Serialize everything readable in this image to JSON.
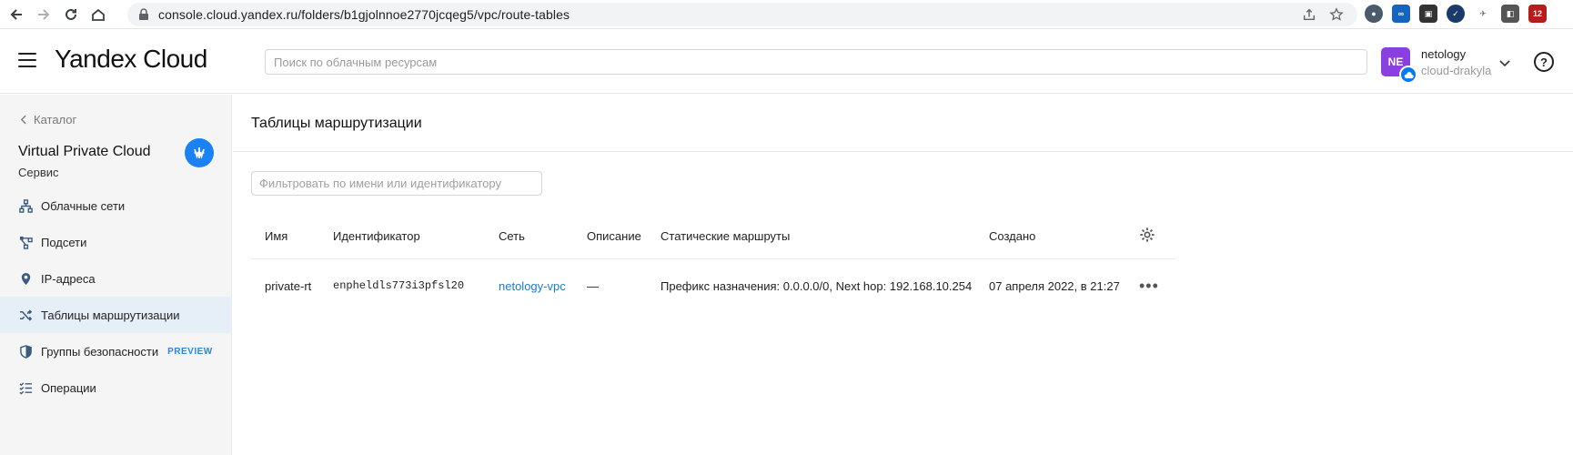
{
  "browser": {
    "url": "console.cloud.yandex.ru/folders/b1gjolnnoe2770jcqeg5/vpc/route-tables",
    "extension_badge": "12"
  },
  "header": {
    "brand": "Yandex Cloud",
    "search_placeholder": "Поиск по облачным ресурсам",
    "avatar_initials": "NE",
    "user_name": "netology",
    "cloud_name": "cloud-drakyla"
  },
  "sidebar": {
    "back_label": "Каталог",
    "service_title": "Virtual Private Cloud",
    "service_subtitle": "Сервис",
    "items": [
      {
        "label": "Облачные сети",
        "icon": "network-icon"
      },
      {
        "label": "Подсети",
        "icon": "subnet-icon"
      },
      {
        "label": "IP-адреса",
        "icon": "location-pin-icon"
      },
      {
        "label": "Таблицы маршрутизации",
        "icon": "shuffle-icon",
        "active": true
      },
      {
        "label": "Группы безопасности",
        "icon": "shield-icon",
        "badge": "PREVIEW"
      },
      {
        "label": "Операции",
        "icon": "checklist-icon"
      }
    ]
  },
  "main": {
    "title": "Таблицы маршрутизации",
    "filter_placeholder": "Фильтровать по имени или идентификатору",
    "columns": [
      "Имя",
      "Идентификатор",
      "Сеть",
      "Описание",
      "Статические маршруты",
      "Создано"
    ],
    "rows": [
      {
        "name": "private-rt",
        "id": "enpheldls773i3pfsl20",
        "network": "netology-vpc",
        "description": "—",
        "routes": "Префикс назначения: 0.0.0.0/0, Next hop: 192.168.10.254",
        "created": "07 апреля 2022, в 21:27",
        "actions": "•••"
      }
    ]
  },
  "colors": {
    "accent": "#027bf3",
    "avatar": "#8a3fe0",
    "active_item_bg": "#e6eef7",
    "link": "#1f79d4"
  }
}
